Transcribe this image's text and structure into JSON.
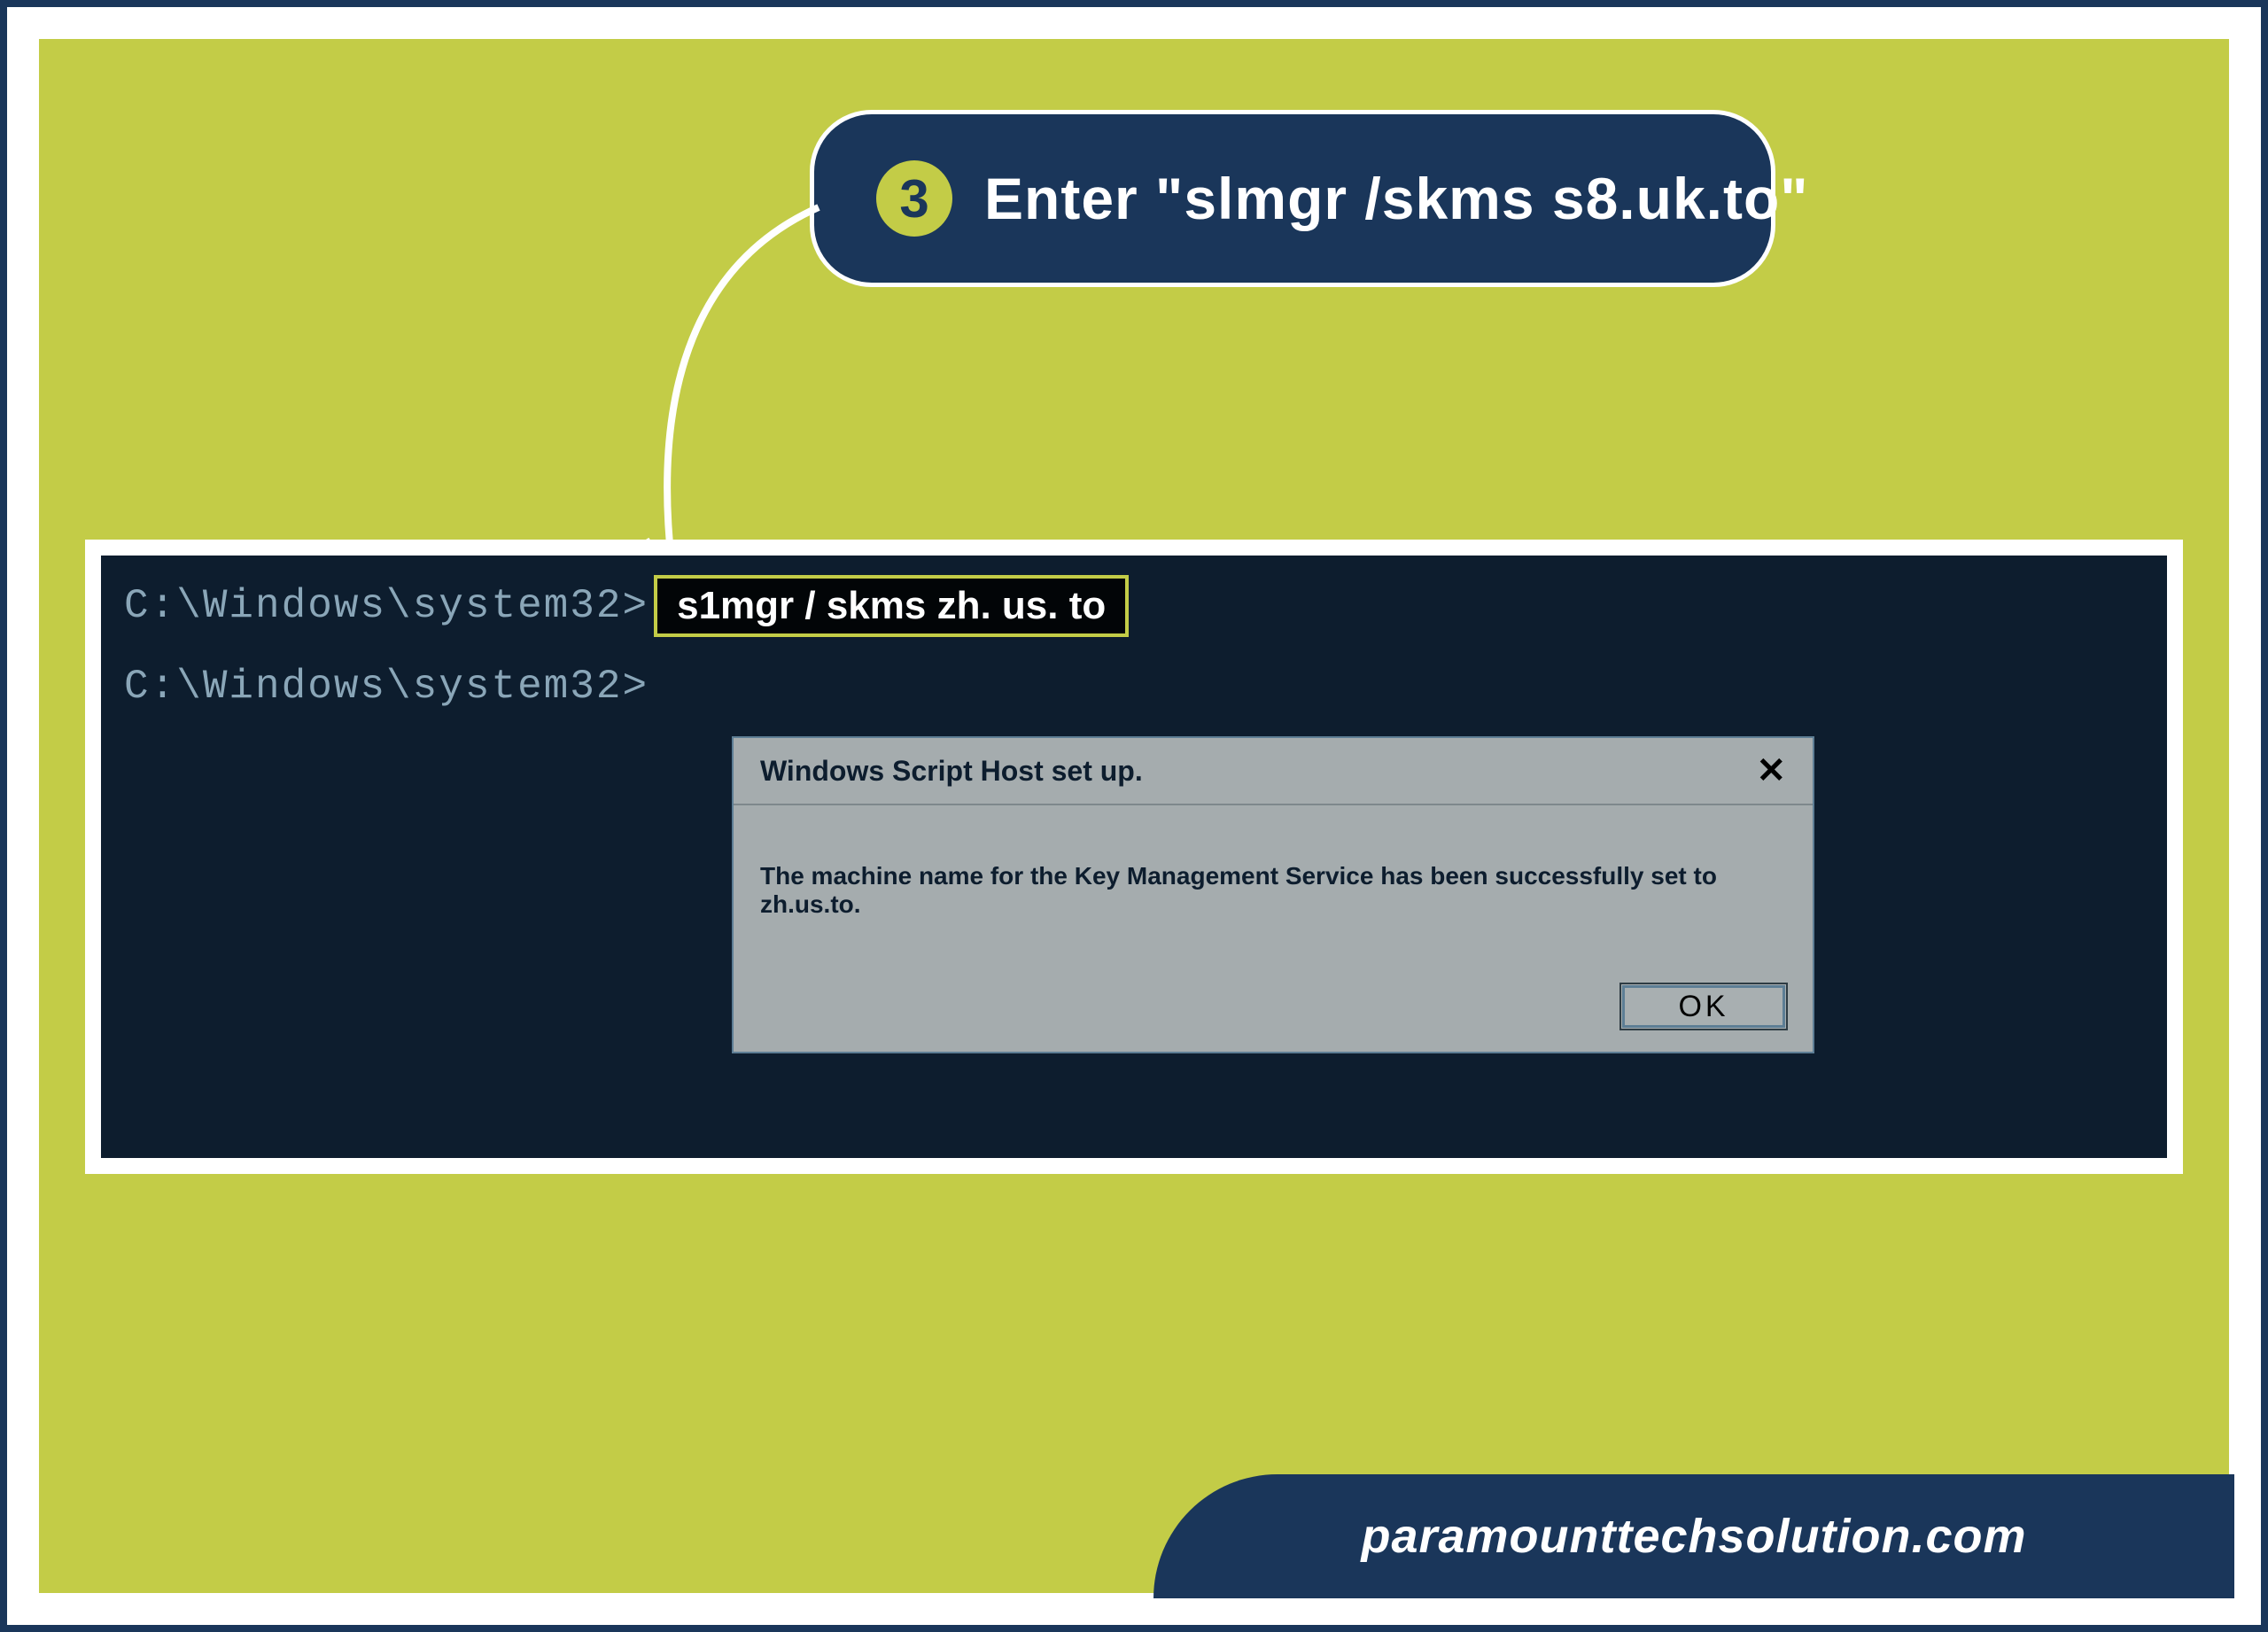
{
  "callout": {
    "number": "3",
    "text": "Enter \"slmgr /skms s8.uk.to\""
  },
  "terminal": {
    "prompt1": "C:\\Windows\\system32>",
    "highlight_cmd": "s1mgr  / skms  zh. us. to",
    "prompt2": "C:\\Windows\\system32>"
  },
  "dialog": {
    "title": "Windows Script Host set up.",
    "body": "The machine name for the Key Management Service has been successfully set to zh.us.to.",
    "ok_label": "OK"
  },
  "footer": {
    "url": "paramounttechsolution.com"
  }
}
